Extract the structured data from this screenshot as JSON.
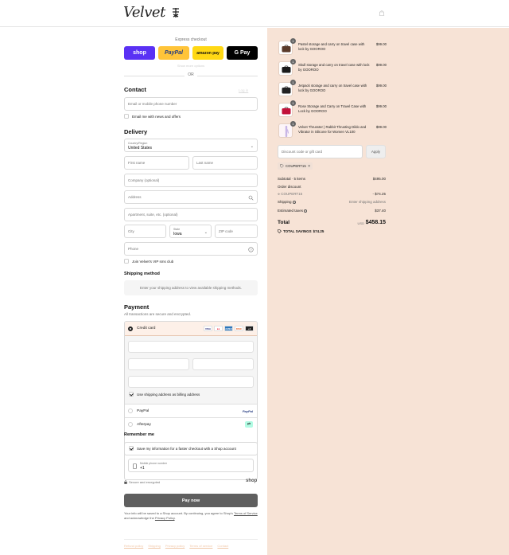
{
  "header": {
    "logo_text": "Velvet"
  },
  "express": {
    "title": "Express checkout",
    "shop": "shop",
    "paypal": "PayPal",
    "amazon": "amazon pay",
    "gpay": "G Pay",
    "show_more": "Show more options",
    "or": "OR"
  },
  "contact": {
    "heading": "Contact",
    "login": "Log in",
    "email_placeholder": "Email or mobile phone number",
    "news_label": "Email me with news and offers"
  },
  "delivery": {
    "heading": "Delivery",
    "country_label": "Country/Region",
    "country_value": "United States",
    "first_name": "First name",
    "last_name": "Last name",
    "company": "Company (optional)",
    "address": "Address",
    "apartment": "Apartment, suite, etc. (optional)",
    "city": "City",
    "state_label": "State",
    "state_value": "Iowa",
    "zip": "ZIP code",
    "phone": "Phone",
    "sms_label": "Join Velvet's VIP sms club"
  },
  "shipping": {
    "heading": "Shipping method",
    "message": "Enter your shipping address to view available shipping methods."
  },
  "payment": {
    "heading": "Payment",
    "subtitle": "All transactions are secure and encrypted.",
    "credit_card": "Credit card",
    "card_brands": [
      "VISA",
      "MC",
      "AMEX",
      "DISC",
      "+4"
    ],
    "billing_label": "Use shipping address as billing address",
    "paypal": "PayPal",
    "paypal_logo": "PayPal",
    "afterpay": "Afterpay"
  },
  "remember": {
    "heading": "Remember me",
    "save_label": "Save my information for a faster checkout with a Shop account",
    "mobile_label": "Mobile phone number",
    "mobile_value": "+1",
    "secure_text": "Secure and encrypted",
    "shop_brand": "shop"
  },
  "actions": {
    "pay_now": "Pay now"
  },
  "legal": {
    "text_1": "Your info will be saved to a Shop account. By continuing, you agree to Shop's",
    "terms": "Terms of Service",
    "text_2": "and acknowledge the",
    "privacy": "Privacy Policy",
    "end": "."
  },
  "footer": {
    "links": [
      "Refund policy",
      "Shipping",
      "Privacy policy",
      "Terms of service",
      "Contact"
    ]
  },
  "cart": {
    "items": [
      {
        "name": "Pastel storage and carry on travel case with lock by GOOROO",
        "price": "$99.00",
        "qty": "1"
      },
      {
        "name": "Skull storage and carry on travel case with lock by GOOROO",
        "price": "$99.00",
        "qty": "1"
      },
      {
        "name": "Jetpack storage and carry on travel case with lock by GOOROO",
        "price": "$99.00",
        "qty": "1"
      },
      {
        "name": "Rose Storage and Carry on Travel Case with Lock by GOOROO",
        "price": "$99.00",
        "qty": "1"
      },
      {
        "name": "Velvet Thrusster | Rabbit Thrusting Dildo and Vibrator in Silicone for Women VL100",
        "price": "$99.00",
        "qty": "1"
      }
    ],
    "discount_placeholder": "Discount code or gift card",
    "apply": "Apply",
    "code_chip": "COUPERT15",
    "subtotal_label": "Subtotal · 5 items",
    "subtotal_value": "$495.00",
    "order_discount_label": "Order discount",
    "order_discount_code": "COUPERT15",
    "order_discount_value": "- $74.25",
    "shipping_label": "Shipping",
    "shipping_value": "Enter shipping address",
    "taxes_label": "Estimated taxes",
    "taxes_value": "$37.40",
    "total_label": "Total",
    "currency": "USD",
    "total_value": "$458.15",
    "savings_label": "TOTAL SAVINGS",
    "savings_value": "$74.25"
  }
}
